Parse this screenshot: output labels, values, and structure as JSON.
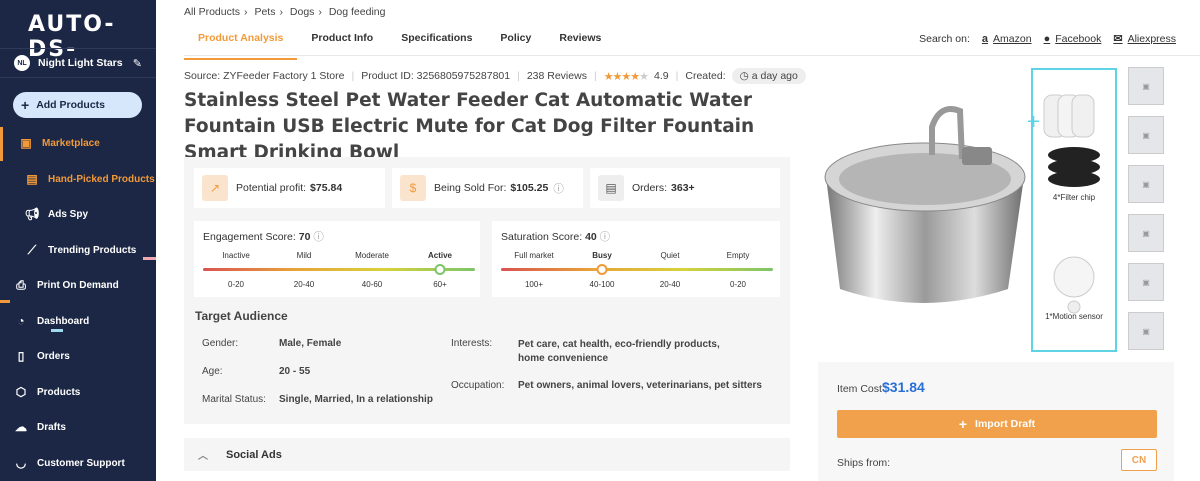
{
  "app": {
    "logo": "AUTO-DS-"
  },
  "store": {
    "initials": "NL",
    "name": "Night Light Stars"
  },
  "sidebar": {
    "add_products": "Add Products",
    "items": [
      {
        "label": "Marketplace"
      },
      {
        "label": "Hand-Picked Products"
      },
      {
        "label": "Ads Spy"
      },
      {
        "label": "Trending Products"
      },
      {
        "label": "Print On Demand"
      },
      {
        "label": "Dashboard"
      },
      {
        "label": "Orders"
      },
      {
        "label": "Products"
      },
      {
        "label": "Drafts"
      },
      {
        "label": "Customer Support"
      }
    ]
  },
  "breadcrumb": [
    "All Products",
    "Pets",
    "Dogs",
    "Dog feeding"
  ],
  "tabs": [
    "Product Analysis",
    "Product Info",
    "Specifications",
    "Policy",
    "Reviews"
  ],
  "search_on": {
    "label": "Search on:",
    "sites": [
      "Amazon",
      "Facebook",
      "Aliexpress"
    ]
  },
  "product": {
    "source": "Source: ZYFeeder Factory 1 Store",
    "product_id": "Product ID: 3256805975287801",
    "reviews": "238 Reviews",
    "rating": "4.9",
    "created_label": "Created:",
    "created_value": "a day ago",
    "title": "Stainless Steel Pet Water Feeder Cat Automatic Water Fountain USB Electric Mute for Cat Dog Filter Fountain Smart Drinking Bowl"
  },
  "stats": {
    "potential_profit_label": "Potential profit:",
    "potential_profit_value": "$75.84",
    "sold_for_label": "Being Sold For:",
    "sold_for_value": "$105.25",
    "orders_label": "Orders:",
    "orders_value": "363+"
  },
  "engagement": {
    "title": "Engagement Score:",
    "score": "70",
    "labels": [
      "Inactive",
      "Mild",
      "Moderate",
      "Active"
    ],
    "ranges": [
      "0-20",
      "20-40",
      "40-60",
      "60+"
    ]
  },
  "saturation": {
    "title": "Saturation Score:",
    "score": "40",
    "labels": [
      "Full market",
      "Busy",
      "Quiet",
      "Empty"
    ],
    "ranges": [
      "100+",
      "40-100",
      "20-40",
      "0-20"
    ]
  },
  "target_audience": {
    "title": "Target Audience",
    "gender_label": "Gender:",
    "gender": "Male, Female",
    "age_label": "Age:",
    "age": "20 - 55",
    "marital_label": "Marital Status:",
    "marital": "Single, Married, In a relationship",
    "interests_label": "Interests:",
    "interests": "Pet care, cat health, eco-friendly products, home convenience",
    "occupation_label": "Occupation:",
    "occupation": "Pet owners, animal lovers, veterinarians, pet sitters"
  },
  "social_ads": "Social Ads",
  "image_annotations": {
    "filter": "4*Filter chip",
    "sensor": "1*Motion sensor"
  },
  "pricing": {
    "item_cost_label": "Item Cost",
    "item_cost": "$31.84",
    "import_label": "Import Draft",
    "ships_from_label": "Ships from:",
    "ships_from_value": "CN"
  }
}
